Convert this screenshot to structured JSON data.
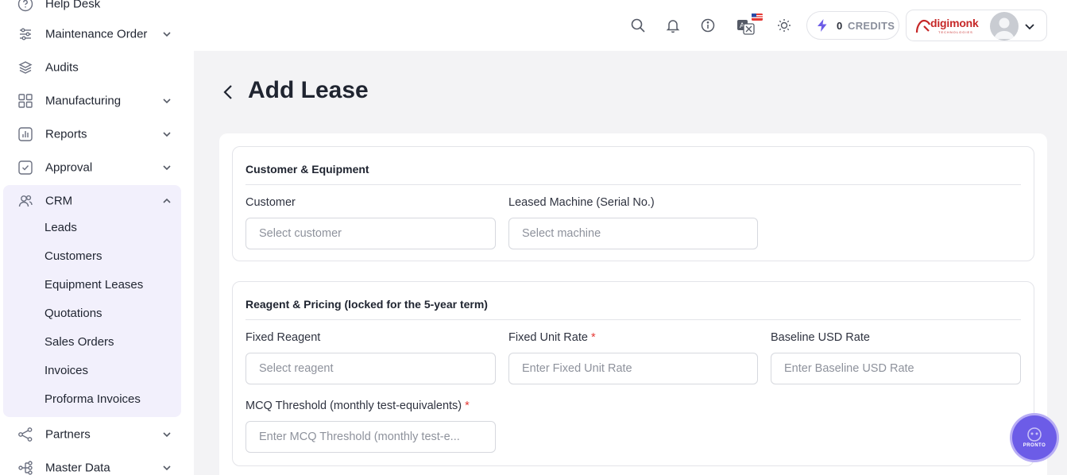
{
  "sidebar": {
    "items": [
      {
        "label": "Help Desk",
        "icon": "help-circle-icon"
      },
      {
        "label": "Maintenance Order",
        "icon": "sliders-icon"
      },
      {
        "label": "Audits",
        "icon": "layers-icon"
      },
      {
        "label": "Manufacturing",
        "icon": "grid-icon"
      },
      {
        "label": "Reports",
        "icon": "bar-chart-icon"
      },
      {
        "label": "Approval",
        "icon": "check-square-icon"
      },
      {
        "label": "CRM",
        "icon": "users-icon"
      },
      {
        "label": "Partners",
        "icon": "share-icon"
      },
      {
        "label": "Master Data",
        "icon": "hierarchy-icon"
      }
    ],
    "crm_children": [
      "Leads",
      "Customers",
      "Equipment Leases",
      "Quotations",
      "Sales Orders",
      "Invoices",
      "Proforma Invoices"
    ]
  },
  "header": {
    "credits_count": "0",
    "credits_label": "CREDITS",
    "brand_name": "digimonk",
    "brand_sub": "TECHNOLOGIES"
  },
  "page": {
    "title": "Add Lease"
  },
  "sections": {
    "customer": {
      "title": "Customer & Equipment",
      "customer_label": "Customer",
      "customer_placeholder": "Select customer",
      "machine_label": "Leased Machine (Serial No.)",
      "machine_placeholder": "Select machine"
    },
    "pricing": {
      "title": "Reagent & Pricing (locked for the 5-year term)",
      "reagent_label": "Fixed Reagent",
      "reagent_placeholder": "Select reagent",
      "unit_rate_label": "Fixed Unit Rate",
      "unit_rate_placeholder": "Enter Fixed Unit Rate",
      "usd_rate_label": "Baseline USD Rate",
      "usd_rate_placeholder": "Enter Baseline USD Rate",
      "mcq_label": "MCQ Threshold (monthly test-equivalents)",
      "mcq_placeholder": "Enter MCQ Threshold (monthly test-e...",
      "required_mark": "*"
    }
  },
  "fab": {
    "label": "PRONTO"
  },
  "colors": {
    "accent": "#6c5ce7",
    "crm_bg": "#f2f0fc",
    "required": "#e53935"
  }
}
